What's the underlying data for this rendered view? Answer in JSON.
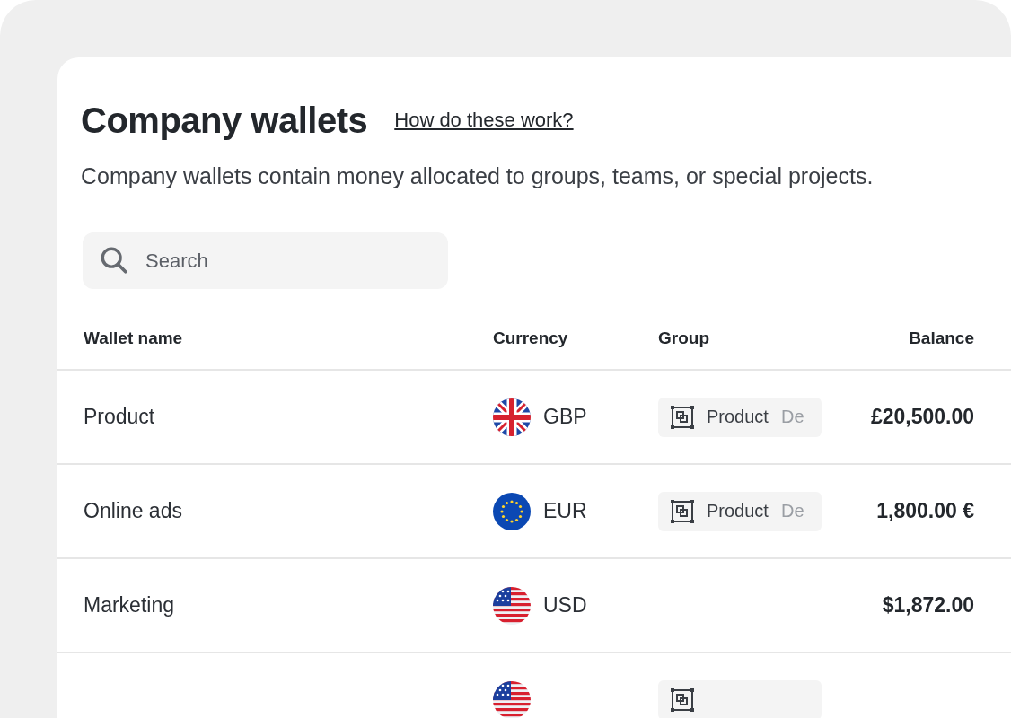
{
  "page": {
    "title": "Company wallets",
    "help_link": "How do these work?",
    "description": "Company wallets contain money allocated to groups, teams, or special projects."
  },
  "search": {
    "placeholder": "Search"
  },
  "table": {
    "columns": [
      "Wallet name",
      "Currency",
      "Group",
      "Balance"
    ],
    "rows": [
      {
        "name": "Product",
        "currency": {
          "code": "GBP",
          "kind": "gb"
        },
        "group": {
          "label": "Product",
          "extra": "De"
        },
        "balance": "£20,500.00"
      },
      {
        "name": "Online ads",
        "currency": {
          "code": "EUR",
          "kind": "eu"
        },
        "group": {
          "label": "Product",
          "extra": "De"
        },
        "balance": "1,800.00 €"
      },
      {
        "name": "Marketing",
        "currency": {
          "code": "USD",
          "kind": "us"
        },
        "balance": "$1,872.00"
      },
      {
        "currency": {
          "kind": "us"
        },
        "group": {}
      }
    ]
  }
}
